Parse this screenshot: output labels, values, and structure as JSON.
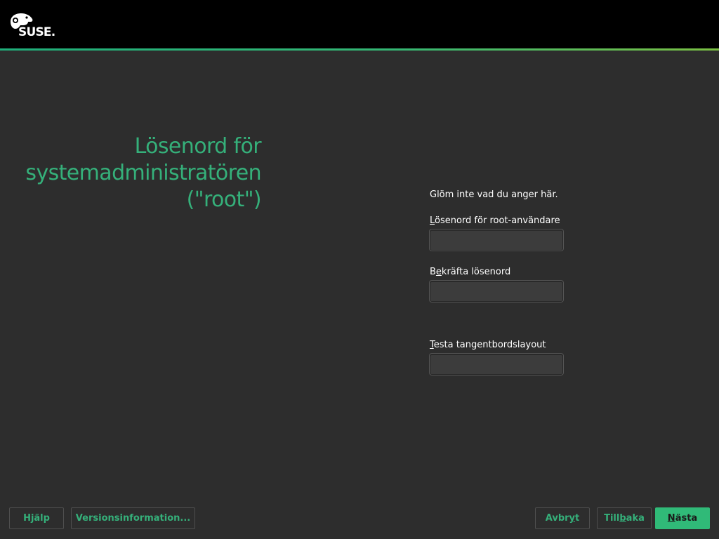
{
  "header": {
    "logo_text": "SUSE.",
    "logo_icon": "chameleon-icon",
    "accent_color": "#30ba78",
    "background_color": "#000000"
  },
  "page": {
    "title": "Lösenord för systemadministratören (\"root\")",
    "title_color": "#35b07a",
    "background_color": "#2d2d2d"
  },
  "form": {
    "info": "Glöm inte vad du anger här.",
    "password": {
      "mnemonic": "L",
      "label_rest": "ösenord för root-användare",
      "value": ""
    },
    "confirm": {
      "label_pre": "B",
      "mnemonic": "e",
      "label_rest": "kräfta lösenord",
      "value": ""
    },
    "keyboard_test": {
      "mnemonic": "T",
      "label_rest": "esta tangentbordslayout",
      "value": ""
    }
  },
  "footer": {
    "help": "Hjälp",
    "release_notes": "Versionsinformation...",
    "abort": {
      "pre": "Avbr",
      "mnemonic": "y",
      "post": "t"
    },
    "back": {
      "pre": "Till",
      "mnemonic": "b",
      "post": "aka"
    },
    "next": {
      "pre": "",
      "mnemonic": "N",
      "post": "ästa"
    }
  }
}
